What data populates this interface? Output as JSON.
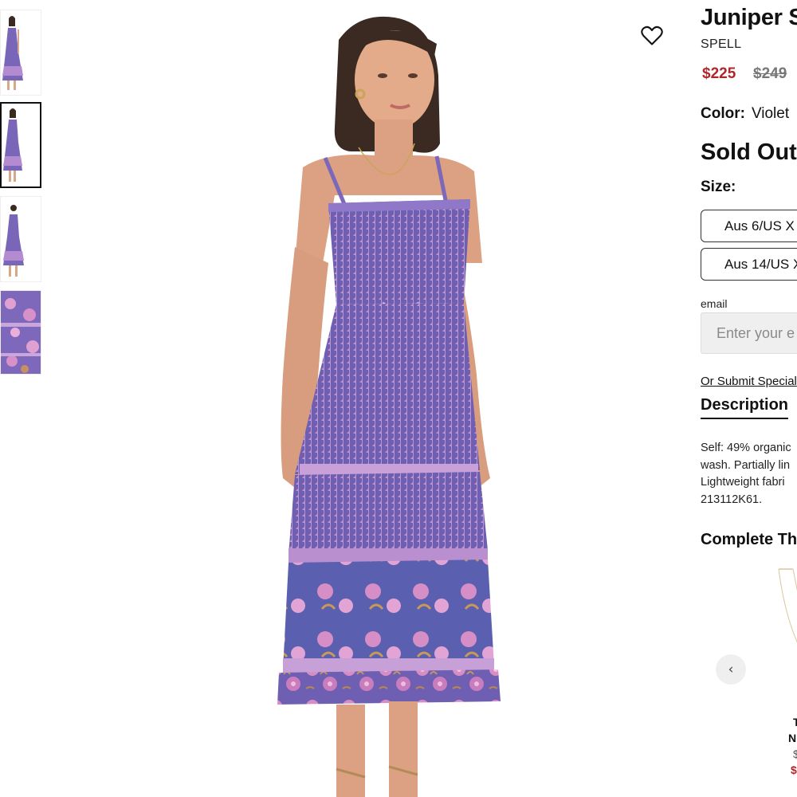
{
  "thumbnails": [
    {
      "label": "Front view",
      "selected": false
    },
    {
      "label": "Side view",
      "selected": true
    },
    {
      "label": "Back view",
      "selected": false
    },
    {
      "label": "Fabric detail",
      "selected": false
    }
  ],
  "favorite": {
    "icon": "heart-icon"
  },
  "product": {
    "title": "Juniper S",
    "brand": "SPELL",
    "price_sale": "$225",
    "price_original": "$249",
    "color_label": "Color:",
    "color_value": "Violet",
    "status": "Sold Out",
    "size_label": "Size:",
    "sizes": [
      "Aus 6/US X",
      "Aus 14/US X"
    ]
  },
  "email": {
    "label": "email",
    "placeholder": "Enter your e"
  },
  "special_order_link": "Or Submit Special",
  "description": {
    "tab_label": "Description",
    "lines": [
      "Self: 49% organic",
      "wash. Partially lin",
      "Lightweight fabri",
      "213112K61."
    ]
  },
  "complete_the_look": {
    "title": "Complete The",
    "prev_icon": "chevron-left-icon",
    "item_lines": [
      "T",
      "N",
      "$",
      "$"
    ]
  },
  "colors": {
    "sale_price": "#b0262a",
    "dress_base": "#6f5fb3",
    "dress_floral": "#d88cc4",
    "accent_dark": "#111111"
  }
}
